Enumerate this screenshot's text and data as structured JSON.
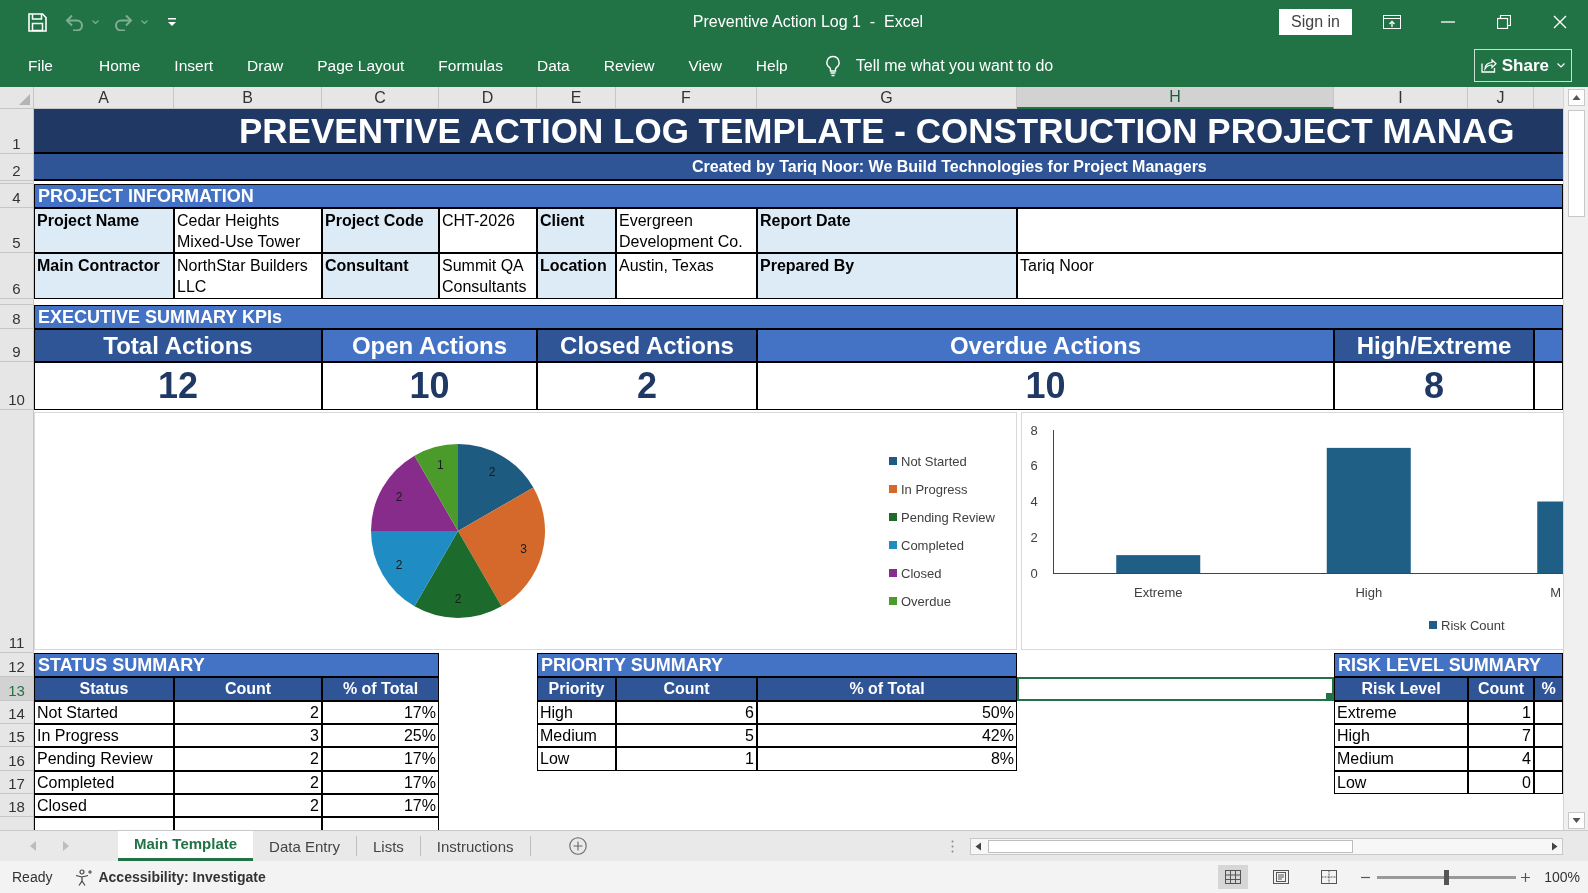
{
  "window": {
    "title": "Preventive Action Log 1  -  Excel",
    "sign_in": "Sign in"
  },
  "quick_access": [
    {
      "kind": "save",
      "disabled": false
    },
    {
      "kind": "undo",
      "disabled": true
    },
    {
      "kind": "redo",
      "disabled": true
    },
    {
      "kind": "customize",
      "disabled": false
    }
  ],
  "ribbon": {
    "tabs": [
      "File",
      "Home",
      "Insert",
      "Draw",
      "Page Layout",
      "Formulas",
      "Data",
      "Review",
      "View",
      "Help"
    ],
    "search": {
      "placeholder": "Tell me what you want to do"
    },
    "share": "Share"
  },
  "column_headers": [
    {
      "label": "A",
      "selected": false
    },
    {
      "label": "B",
      "selected": false
    },
    {
      "label": "C",
      "selected": false
    },
    {
      "label": "D",
      "selected": false
    },
    {
      "label": "E",
      "selected": false
    },
    {
      "label": "F",
      "selected": false
    },
    {
      "label": "G",
      "selected": false
    },
    {
      "label": "H",
      "selected": true
    },
    {
      "label": "I",
      "selected": false
    },
    {
      "label": "J",
      "selected": false
    }
  ],
  "row_headers": [
    {
      "label": "1",
      "selected": false
    },
    {
      "label": "2",
      "selected": false
    },
    {
      "label": "4",
      "selected": false
    },
    {
      "label": "5",
      "selected": false
    },
    {
      "label": "6",
      "selected": false
    },
    {
      "label": "8",
      "selected": false
    },
    {
      "label": "9",
      "selected": false
    },
    {
      "label": "10",
      "selected": false
    },
    {
      "label": "11",
      "selected": false
    },
    {
      "label": "12",
      "selected": false
    },
    {
      "label": "13",
      "selected": true
    },
    {
      "label": "14",
      "selected": false
    },
    {
      "label": "15",
      "selected": false
    },
    {
      "label": "16",
      "selected": false
    },
    {
      "label": "17",
      "selected": false
    },
    {
      "label": "18",
      "selected": false
    }
  ],
  "sheet": {
    "title": "PREVENTIVE ACTION LOG TEMPLATE - CONSTRUCTION PROJECT MANAG",
    "subtitle": "Created by Tariq Noor: We Build Technologies for Project Managers",
    "project_information": {
      "heading": "PROJECT INFORMATION",
      "rows": [
        [
          {
            "label": "Project Name",
            "value": "Cedar Heights Mixed-Use Tower"
          },
          {
            "label": "Project Code",
            "value": "CHT-2026"
          },
          {
            "label": "Client",
            "value": "Evergreen Development Co."
          },
          {
            "label": "Report Date"
          }
        ],
        [
          {
            "label": "Main Contractor",
            "value": "NorthStar Builders LLC"
          },
          {
            "label": "Consultant",
            "value": "Summit QA Consultants"
          },
          {
            "label": "Location",
            "value": "Austin, Texas"
          },
          {
            "label": "Prepared By",
            "value": "Tariq Noor"
          }
        ]
      ]
    },
    "executive_summary": {
      "heading": "EXECUTIVE SUMMARY KPIs",
      "kpis": [
        {
          "label": "Total Actions",
          "value": "12"
        },
        {
          "label": "Open Actions",
          "value": "10"
        },
        {
          "label": "Closed Actions",
          "value": "2"
        },
        {
          "label": "Overdue Actions",
          "value": "10"
        },
        {
          "label": "High/Extreme",
          "value": "8"
        }
      ]
    },
    "status_chart": {
      "chart_data": {
        "type": "pie",
        "categories": [
          "Not Started",
          "In Progress",
          "Pending Review",
          "Completed",
          "Closed",
          "Overdue"
        ],
        "values": [
          2,
          3,
          2,
          2,
          2,
          1
        ],
        "colors": [
          "#1d5b80",
          "#d4692b",
          "#1c6a2c",
          "#1f8dc4",
          "#872c8b",
          "#4b9b2b"
        ],
        "data_labels": true,
        "legend": "right"
      }
    },
    "risk_chart": {
      "chart_data": {
        "type": "bar",
        "categories": [
          "Extreme",
          "High",
          "M"
        ],
        "series": [
          {
            "name": "Risk Count",
            "color": "#1f5f85",
            "values": [
              1,
              7,
              4
            ]
          }
        ],
        "ylim": [
          0,
          8
        ],
        "yticks": [
          0,
          2,
          4,
          6,
          8
        ],
        "legend": "bottom"
      }
    },
    "status_summary": {
      "heading": "STATUS SUMMARY",
      "columns": [
        "Status",
        "Count",
        "% of Total"
      ],
      "rows": [
        [
          "Not Started",
          "2",
          "17%"
        ],
        [
          "In Progress",
          "3",
          "25%"
        ],
        [
          "Pending Review",
          "2",
          "17%"
        ],
        [
          "Completed",
          "2",
          "17%"
        ],
        [
          "Closed",
          "2",
          "17%"
        ]
      ]
    },
    "priority_summary": {
      "heading": "PRIORITY SUMMARY",
      "columns": [
        "Priority",
        "Count",
        "% of Total"
      ],
      "rows": [
        [
          "High",
          "6",
          "50%"
        ],
        [
          "Medium",
          "5",
          "42%"
        ],
        [
          "Low",
          "1",
          "8%"
        ]
      ]
    },
    "risk_level_summary": {
      "heading": "RISK LEVEL SUMMARY",
      "columns": [
        "Risk Level",
        "Count",
        "%"
      ],
      "rows": [
        [
          "Extreme",
          "1"
        ],
        [
          "High",
          "7"
        ],
        [
          "Medium",
          "4"
        ],
        [
          "Low",
          "0"
        ]
      ]
    }
  },
  "sheet_tabs": [
    {
      "label": "Main Template",
      "selected": true
    },
    {
      "label": "Data Entry",
      "selected": false
    },
    {
      "label": "Lists",
      "selected": false
    },
    {
      "label": "Instructions",
      "selected": false
    }
  ],
  "status_bar": {
    "status": "Ready",
    "accessibility": "Accessibility: Investigate",
    "views": [
      {
        "kind": "normal",
        "selected": true
      },
      {
        "kind": "page_layout",
        "selected": false
      },
      {
        "kind": "page_break",
        "selected": false
      }
    ],
    "zoom": {
      "level": 0.5,
      "reading": "100%"
    }
  }
}
